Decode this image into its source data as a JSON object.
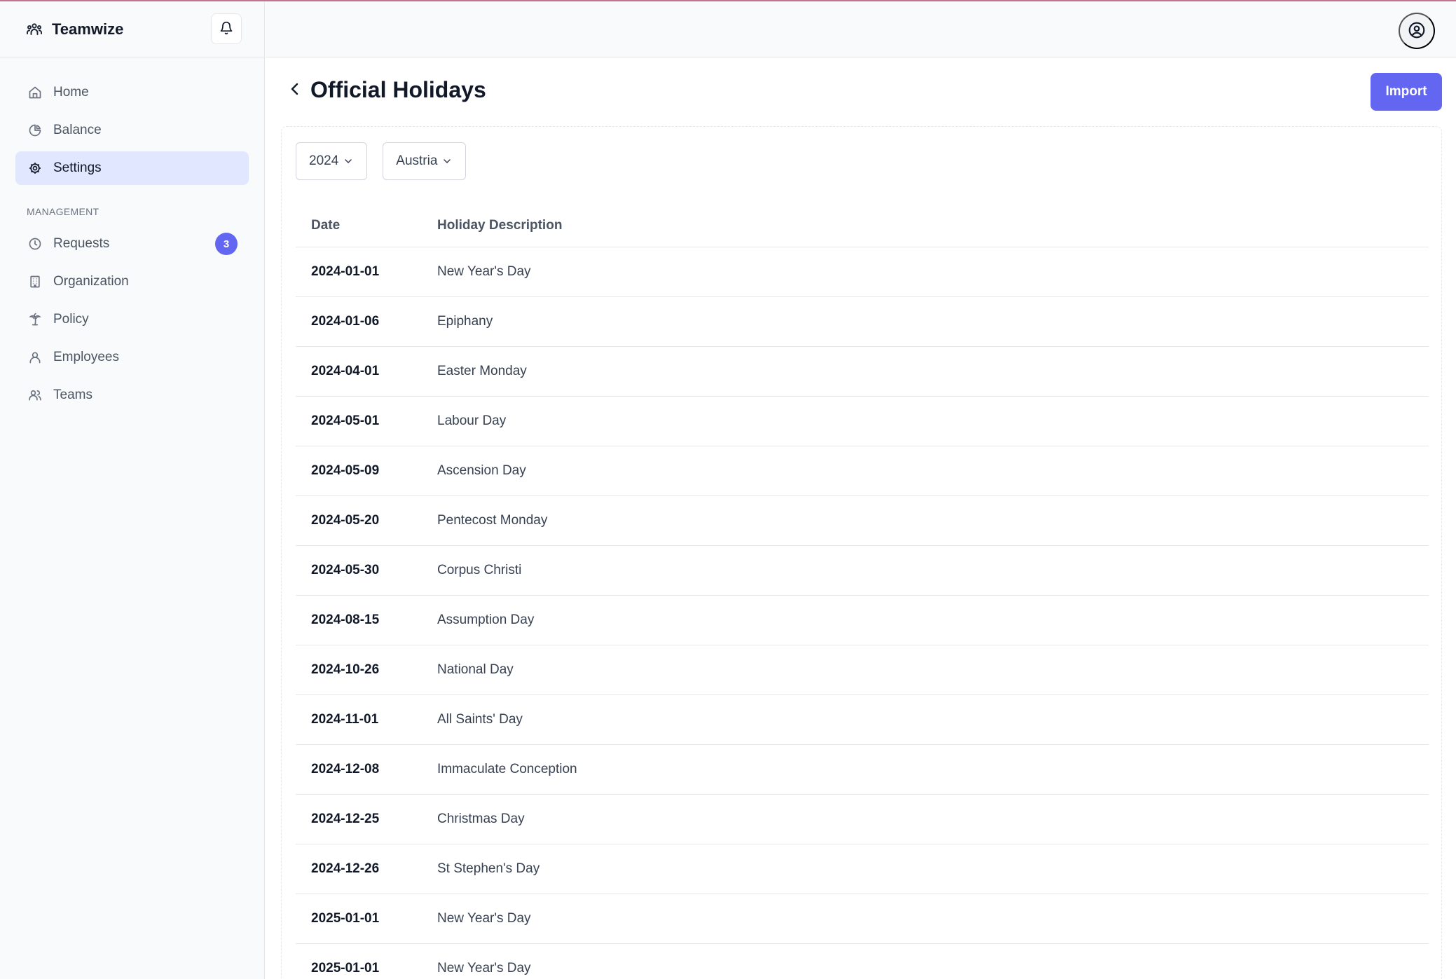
{
  "app": {
    "name": "Teamwize"
  },
  "sidebar": {
    "items": [
      {
        "label": "Home",
        "icon": "home-icon"
      },
      {
        "label": "Balance",
        "icon": "pie-chart-icon"
      },
      {
        "label": "Settings",
        "icon": "gear-icon",
        "active": true
      }
    ],
    "section_label": "MANAGEMENT",
    "management_items": [
      {
        "label": "Requests",
        "icon": "clock-icon",
        "badge": "3"
      },
      {
        "label": "Organization",
        "icon": "building-icon"
      },
      {
        "label": "Policy",
        "icon": "palm-tree-icon"
      },
      {
        "label": "Employees",
        "icon": "user-icon"
      },
      {
        "label": "Teams",
        "icon": "users-icon"
      }
    ]
  },
  "page": {
    "title": "Official Holidays",
    "import_label": "Import"
  },
  "filters": {
    "year": "2024",
    "country": "Austria"
  },
  "table": {
    "columns": [
      "Date",
      "Holiday Description"
    ],
    "rows": [
      {
        "date": "2024-01-01",
        "description": "New Year's Day"
      },
      {
        "date": "2024-01-06",
        "description": "Epiphany"
      },
      {
        "date": "2024-04-01",
        "description": "Easter Monday"
      },
      {
        "date": "2024-05-01",
        "description": "Labour Day"
      },
      {
        "date": "2024-05-09",
        "description": "Ascension Day"
      },
      {
        "date": "2024-05-20",
        "description": "Pentecost Monday"
      },
      {
        "date": "2024-05-30",
        "description": "Corpus Christi"
      },
      {
        "date": "2024-08-15",
        "description": "Assumption Day"
      },
      {
        "date": "2024-10-26",
        "description": "National Day"
      },
      {
        "date": "2024-11-01",
        "description": "All Saints' Day"
      },
      {
        "date": "2024-12-08",
        "description": "Immaculate Conception"
      },
      {
        "date": "2024-12-25",
        "description": "Christmas Day"
      },
      {
        "date": "2024-12-26",
        "description": "St Stephen's Day"
      },
      {
        "date": "2025-01-01",
        "description": "New Year's Day"
      },
      {
        "date": "2025-01-01",
        "description": "New Year's Day"
      }
    ]
  },
  "colors": {
    "accent": "#6366f1",
    "active_nav_bg": "#e0e7ff",
    "sidebar_bg": "#f9fafb"
  }
}
